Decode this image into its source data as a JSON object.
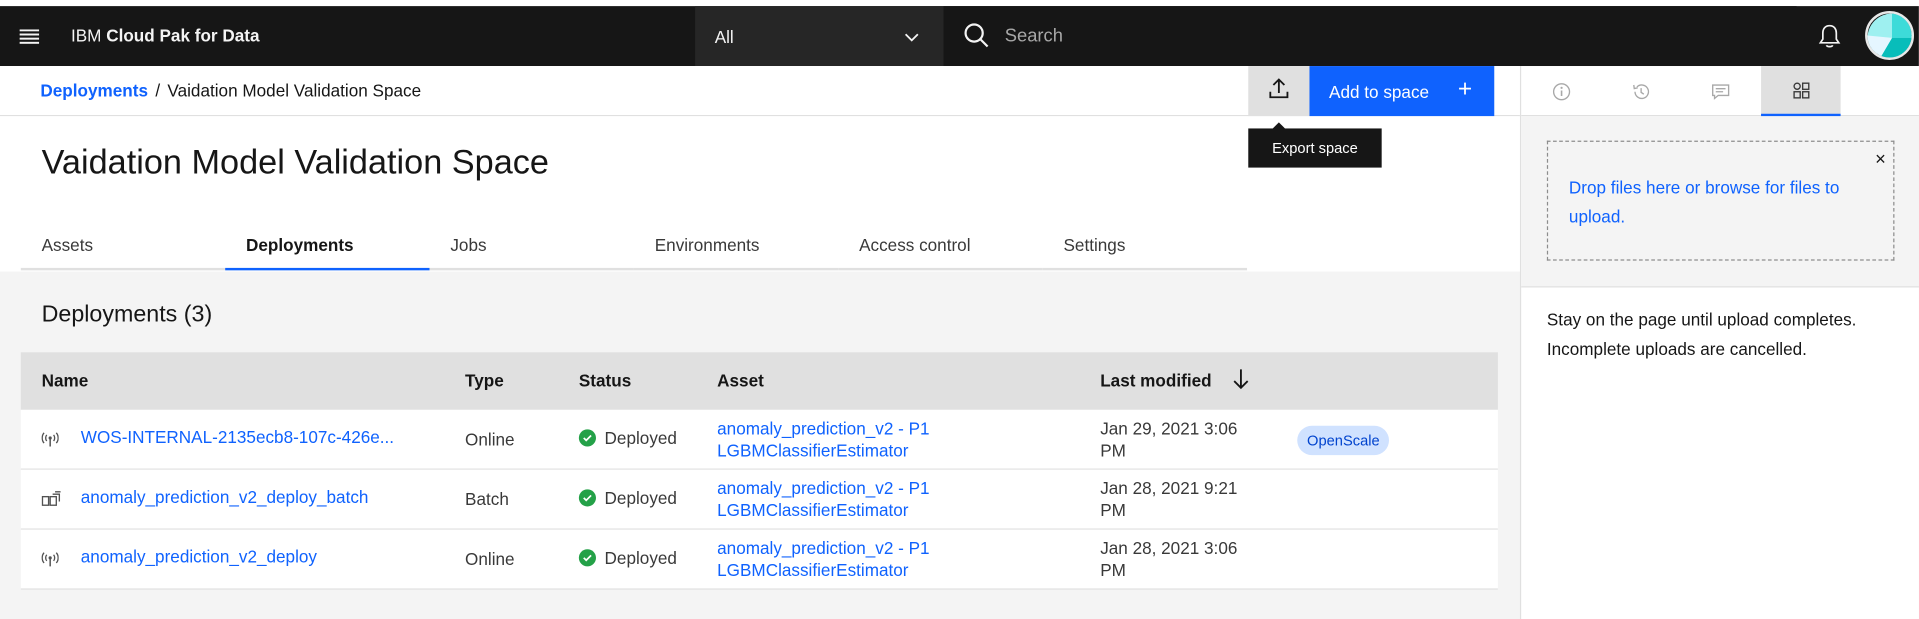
{
  "header": {
    "brand_prefix": "IBM",
    "brand_name": "Cloud Pak for Data",
    "scope_value": "All",
    "search_placeholder": "Search"
  },
  "breadcrumb": {
    "parent": "Deployments",
    "separator": "/",
    "current": "Vaidation Model Validation Space"
  },
  "toolbar": {
    "export_tooltip": "Export space",
    "add_label": "Add to space",
    "add_icon": "+"
  },
  "page": {
    "title": "Vaidation Model Validation Space"
  },
  "tabs": [
    {
      "label": "Assets"
    },
    {
      "label": "Deployments"
    },
    {
      "label": "Jobs"
    },
    {
      "label": "Environments"
    },
    {
      "label": "Access control"
    },
    {
      "label": "Settings"
    }
  ],
  "section": {
    "title": "Deployments (3)"
  },
  "table": {
    "columns": [
      "Name",
      "Type",
      "Status",
      "Asset",
      "Last modified"
    ],
    "rows": [
      {
        "icon": "online-deployment-icon",
        "name": "WOS-INTERNAL-2135ecb8-107c-426e...",
        "type": "Online",
        "status": "Deployed",
        "asset_line1": "anomaly_prediction_v2 - P1",
        "asset_line2": "LGBMClassifierEstimator",
        "modified_line1": "Jan 29, 2021 3:06",
        "modified_line2": "PM",
        "tag": "OpenScale"
      },
      {
        "icon": "batch-deployment-icon",
        "name": "anomaly_prediction_v2_deploy_batch",
        "type": "Batch",
        "status": "Deployed",
        "asset_line1": "anomaly_prediction_v2 - P1",
        "asset_line2": "LGBMClassifierEstimator",
        "modified_line1": "Jan 28, 2021 9:21",
        "modified_line2": "PM",
        "tag": ""
      },
      {
        "icon": "online-deployment-icon",
        "name": "anomaly_prediction_v2_deploy",
        "type": "Online",
        "status": "Deployed",
        "asset_line1": "anomaly_prediction_v2 - P1",
        "asset_line2": "LGBMClassifierEstimator",
        "modified_line1": "Jan 28, 2021 3:06",
        "modified_line2": "PM",
        "tag": ""
      }
    ]
  },
  "right_panel": {
    "tabs": [
      "info-icon",
      "history-icon",
      "comment-icon",
      "data-assets-icon"
    ],
    "dropzone_text": "Drop files here or browse for files to upload.",
    "close_icon": "×",
    "note": "Stay on the page until upload completes. Incomplete uploads are cancelled."
  },
  "colors": {
    "accent": "#0f62fe",
    "header_bg": "#161616",
    "success": "#24a148",
    "tag_bg": "#d0e2ff"
  }
}
